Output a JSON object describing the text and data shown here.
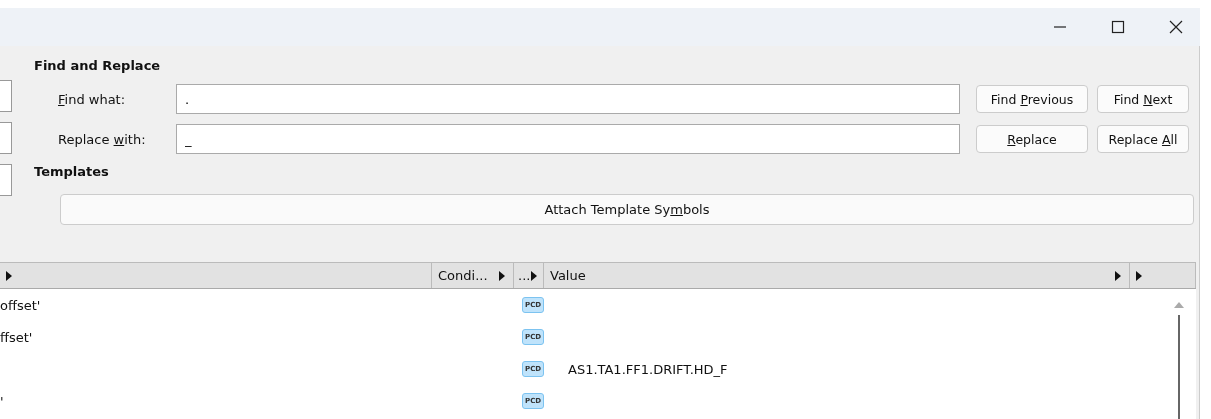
{
  "window": {
    "controls": [
      {
        "kind": "minimize"
      },
      {
        "kind": "maximize"
      },
      {
        "kind": "close"
      }
    ]
  },
  "find_replace": {
    "title": "Find and Replace",
    "fields": [
      {
        "label": {
          "key": "F",
          "after": "ind what:"
        },
        "value": "."
      },
      {
        "label": {
          "before": "Replace ",
          "key": "w",
          "after": "ith:"
        },
        "value": "_"
      }
    ],
    "buttons": [
      {
        "before": "Find ",
        "key": "P",
        "after": "revious"
      },
      {
        "before": "Find ",
        "key": "N",
        "after": "ext"
      },
      {
        "key": "R",
        "after": "eplace"
      },
      {
        "before": "Replace ",
        "key": "A",
        "after": "ll"
      }
    ]
  },
  "templates": {
    "title": "Templates",
    "button": {
      "before": "Attach Template Sy",
      "key": "m",
      "after": "bols"
    }
  },
  "table": {
    "columns": [
      {},
      {
        "label": "Condi..."
      },
      {
        "label": "..."
      },
      {
        "label": "Value"
      },
      {}
    ],
    "rows": [
      {
        "name": "offset'",
        "badge": "PCD"
      },
      {
        "name": "ffset'",
        "badge": "PCD"
      },
      {
        "badge": "PCD",
        "value": "AS1.TA1.FF1.DRIFT.HD_F"
      },
      {
        "name": "'",
        "badge": "PCD"
      }
    ]
  }
}
